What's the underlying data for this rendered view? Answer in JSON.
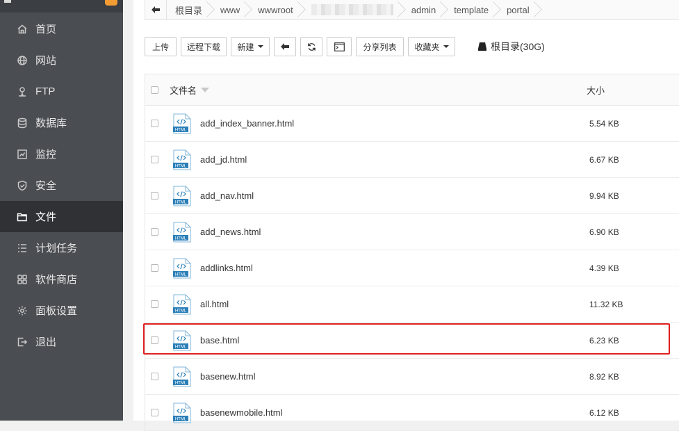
{
  "sidebar": {
    "items": [
      {
        "label": "首页",
        "icon": "home-icon",
        "active": false
      },
      {
        "label": "网站",
        "icon": "globe-icon",
        "active": false
      },
      {
        "label": "FTP",
        "icon": "ftp-icon",
        "active": false
      },
      {
        "label": "数据库",
        "icon": "database-icon",
        "active": false
      },
      {
        "label": "监控",
        "icon": "monitor-icon",
        "active": false
      },
      {
        "label": "安全",
        "icon": "shield-icon",
        "active": false
      },
      {
        "label": "文件",
        "icon": "folder-icon",
        "active": true
      },
      {
        "label": "计划任务",
        "icon": "task-icon",
        "active": false
      },
      {
        "label": "软件商店",
        "icon": "store-icon",
        "active": false
      },
      {
        "label": "面板设置",
        "icon": "gear-icon",
        "active": false
      },
      {
        "label": "退出",
        "icon": "logout-icon",
        "active": false
      }
    ]
  },
  "breadcrumb": {
    "items": [
      "根目录",
      "www",
      "wwwroot",
      "",
      "admin",
      "template",
      "portal"
    ]
  },
  "toolbar": {
    "upload": "上传",
    "remote_download": "远程下载",
    "new": "新建",
    "share_list": "分享列表",
    "favorites": "收藏夹",
    "disk": "根目录(30G)"
  },
  "table": {
    "header_name": "文件名",
    "header_size": "大小",
    "rows": [
      {
        "name": "add_index_banner.html",
        "size": "5.54 KB"
      },
      {
        "name": "add_jd.html",
        "size": "6.67 KB"
      },
      {
        "name": "add_nav.html",
        "size": "9.94 KB"
      },
      {
        "name": "add_news.html",
        "size": "6.90 KB"
      },
      {
        "name": "addlinks.html",
        "size": "4.39 KB"
      },
      {
        "name": "all.html",
        "size": "11.32 KB"
      },
      {
        "name": "base.html",
        "size": "6.23 KB"
      },
      {
        "name": "basenew.html",
        "size": "8.92 KB"
      },
      {
        "name": "basenewmobile.html",
        "size": "6.12 KB"
      }
    ],
    "file_icon_label": "HTML",
    "highlighted_row": "base.html"
  },
  "colors": {
    "sidebar_bg": "#4a4d51",
    "sidebar_active": "#2f3134",
    "highlight_border": "#e02020",
    "file_icon": "#2b7fb8"
  }
}
